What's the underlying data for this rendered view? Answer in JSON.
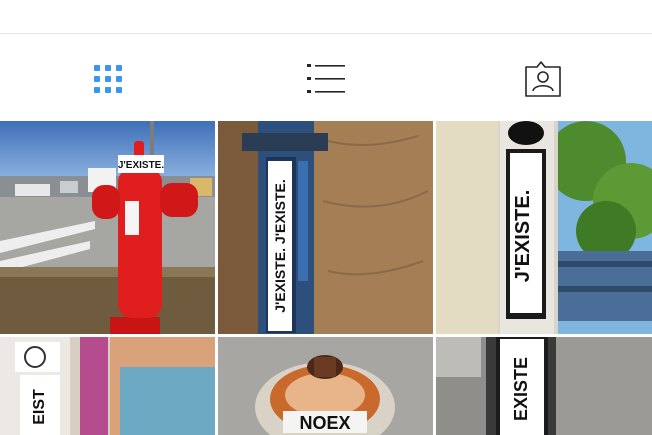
{
  "header": {
    "partial_text": ""
  },
  "view_tabs": [
    {
      "id": "grid",
      "icon": "grid-icon",
      "active": true
    },
    {
      "id": "list",
      "icon": "list-icon",
      "active": false
    },
    {
      "id": "tagged",
      "icon": "tagged-person-icon",
      "active": false
    }
  ],
  "colors": {
    "active_tab": "#3897f0",
    "inactive_tab": "#262626"
  },
  "posts": [
    {
      "subject": "red fire hydrant",
      "sticker_text": "J'EXISTE."
    },
    {
      "subject": "sticker on wooden post",
      "sticker_text": "J'EXISTE."
    },
    {
      "subject": "sticker on lamp post",
      "sticker_text": "J'EXISTE."
    },
    {
      "subject": "stickers on wall",
      "sticker_text": "EIST"
    },
    {
      "subject": "stickers on hydrant top",
      "sticker_text": "NOEX"
    },
    {
      "subject": "sticker on pole",
      "sticker_text": "EXISTE"
    }
  ]
}
